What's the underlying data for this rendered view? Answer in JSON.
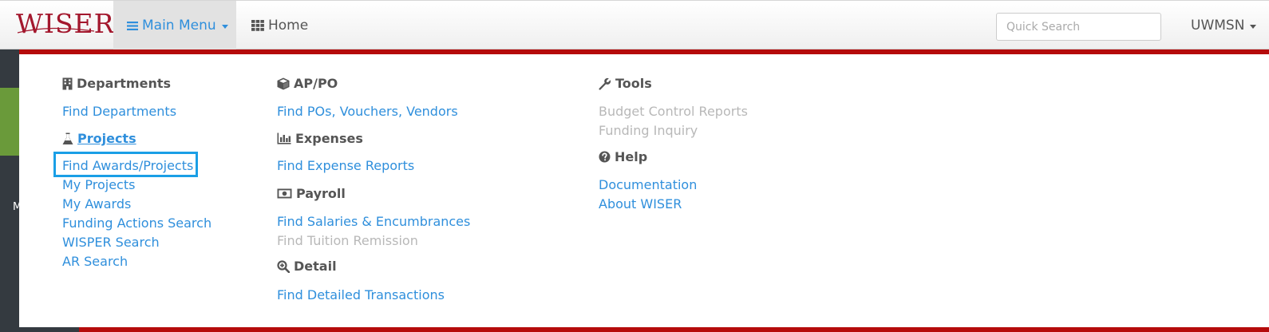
{
  "navbar": {
    "brand": "WISER",
    "main_menu_label": "Main Menu",
    "home_label": "Home",
    "search_placeholder": "Quick Search",
    "user_label": "UWMSN"
  },
  "sidebar": {
    "letter": "M"
  },
  "menu": {
    "departments": {
      "heading": "Departments",
      "links": [
        "Find Departments"
      ]
    },
    "projects": {
      "heading": "Projects",
      "links": [
        "Find Awards/Projects",
        "My Projects",
        "My Awards",
        "Funding Actions Search",
        "WISPER Search",
        "AR Search"
      ]
    },
    "appo": {
      "heading": "AP/PO",
      "links": [
        "Find POs, Vouchers, Vendors"
      ]
    },
    "expenses": {
      "heading": "Expenses",
      "links": [
        "Find Expense Reports"
      ]
    },
    "payroll": {
      "heading": "Payroll",
      "links": [
        "Find Salaries & Encumbrances",
        "Find Tuition Remission"
      ]
    },
    "detail": {
      "heading": "Detail",
      "links": [
        "Find Detailed Transactions"
      ]
    },
    "tools": {
      "heading": "Tools",
      "links": [
        "Budget Control Reports",
        "Funding Inquiry"
      ]
    },
    "help": {
      "heading": "Help",
      "links": [
        "Documentation",
        "About WISER"
      ]
    }
  },
  "colors": {
    "brand": "#a3172d",
    "link": "#2f8fdc",
    "disabled": "#b8b8b8",
    "menu_border": "#b50b0b",
    "highlight": "#1a9fe6"
  }
}
